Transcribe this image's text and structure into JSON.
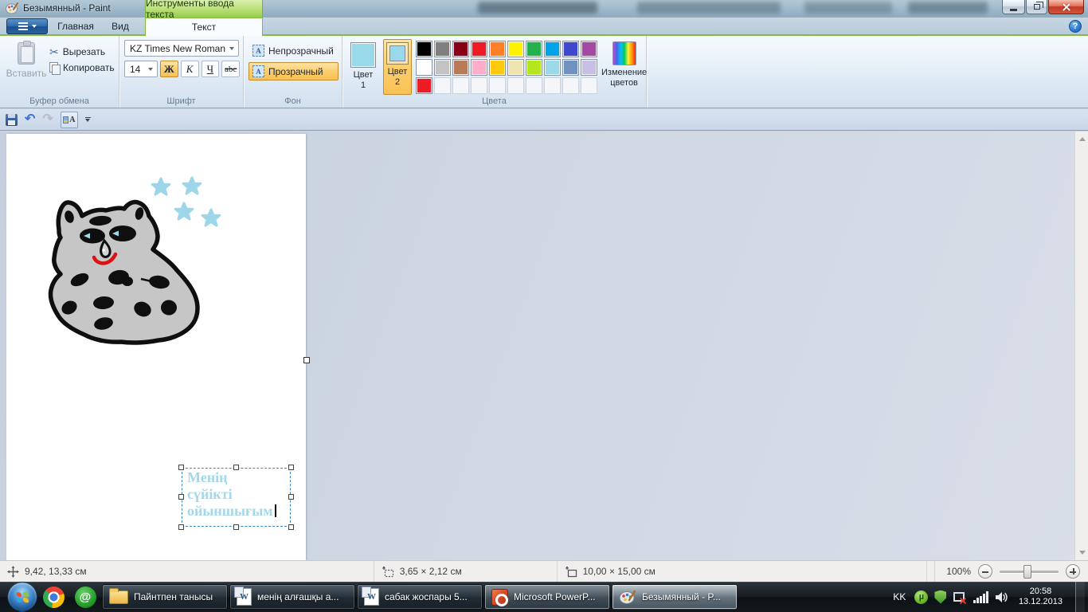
{
  "window": {
    "title": "Безымянный - Paint",
    "contextual_tab_title": "Инструменты ввода текста"
  },
  "tabs": {
    "home": "Главная",
    "view": "Вид",
    "text": "Текст"
  },
  "ribbon": {
    "clipboard": {
      "label": "Буфер обмена",
      "paste": "Вставить",
      "cut": "Вырезать",
      "copy": "Копировать"
    },
    "font": {
      "label": "Шрифт",
      "family": "KZ Times New Roman",
      "size": "14",
      "bold": "Ж",
      "italic": "К",
      "underline": "Ч",
      "strike": "abc"
    },
    "background": {
      "label": "Фон",
      "opaque": "Непрозрачный",
      "transparent": "Прозрачный"
    },
    "colors": {
      "label": "Цвета",
      "color1_line1": "Цвет",
      "color1_line2": "1",
      "color2_line1": "Цвет",
      "color2_line2": "2",
      "edit_line1": "Изменение",
      "edit_line2": "цветов",
      "color1": "#99d9ea",
      "color2": "#99d9ea",
      "palette": [
        [
          "#000000",
          "#7f7f7f",
          "#880015",
          "#ed1c24",
          "#ff7f27",
          "#fff200",
          "#22b14c",
          "#00a2e8",
          "#3f48cc",
          "#a349a4"
        ],
        [
          "#ffffff",
          "#c3c3c3",
          "#b97a57",
          "#ffaec9",
          "#ffc90e",
          "#efe4b0",
          "#b5e61d",
          "#99d9ea",
          "#7092be",
          "#c8bfe7"
        ],
        [
          "#ed1c24",
          null,
          null,
          null,
          null,
          null,
          null,
          null,
          null,
          null
        ]
      ]
    }
  },
  "canvas": {
    "text_lines": [
      "Менің",
      "сүйікті",
      "ойыншығым"
    ],
    "text_color": "#a3d8ea",
    "drawing_description": "gray spotted bear with light blue stars"
  },
  "status": {
    "cursor_position": "9,42, 13,33 см",
    "selection_size": "3,65 × 2,12 см",
    "image_size": "10,00 × 15,00 см",
    "zoom_level": "100%"
  },
  "taskbar": {
    "buttons": [
      {
        "label": "Пайнтпен танысы",
        "icon": "folder"
      },
      {
        "label": "менің алғашқы а...",
        "icon": "word"
      },
      {
        "label": "сабак жоспары 5...",
        "icon": "word"
      },
      {
        "label": "Microsoft PowerP...",
        "icon": "powerpoint"
      },
      {
        "label": "Безымянный - P...",
        "icon": "paint",
        "active": true
      }
    ],
    "tray": {
      "language": "KK",
      "time": "20:58",
      "date": "13.12.2013"
    }
  },
  "icons": {
    "scissors": "✂",
    "undo": "↶",
    "redo": "↷",
    "help": "?",
    "agent_at": "@",
    "utorrent_mu": "µ",
    "word_w": "W"
  }
}
